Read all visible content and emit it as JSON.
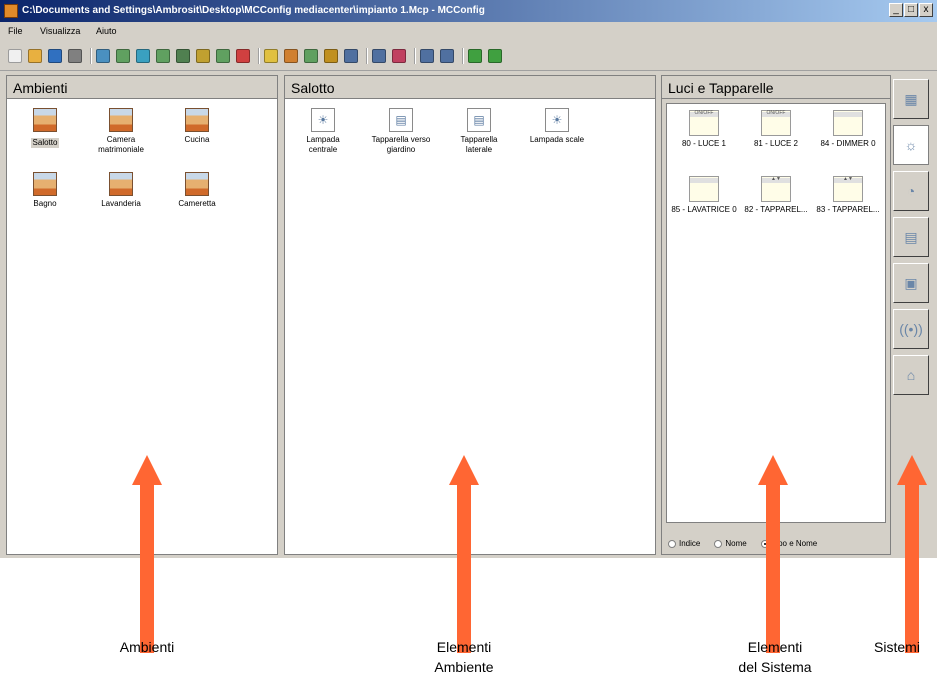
{
  "window": {
    "title": "C:\\Documents and Settings\\Ambrosit\\Desktop\\MCConfig mediacenter\\impianto 1.Mcp - MCConfig",
    "controls": [
      "_",
      "□",
      "x"
    ]
  },
  "menubar": {
    "items": [
      "File",
      "Visualizza",
      "Aiuto"
    ]
  },
  "toolbar": {
    "colors": [
      "#f0f0f0",
      "#e8b040",
      "#3070c0",
      "#808080",
      "#4a90c0",
      "#60a060",
      "#3aa0c0",
      "#60a060",
      "#508050",
      "#c0a030",
      "#60a060",
      "#d04040",
      "#e0c040",
      "#d08030",
      "#60a060",
      "#c09020",
      "#5070a0",
      "#5070a0",
      "#c04060",
      "#5070a0",
      "#5070a0",
      "#40a040",
      "#40a040"
    ]
  },
  "panels": {
    "ambienti": {
      "title": "Ambienti",
      "items": [
        {
          "label": "Salotto",
          "selected": true
        },
        {
          "label": "Camera matrimoniale",
          "selected": false
        },
        {
          "label": "Cucina",
          "selected": false
        },
        {
          "label": "Bagno",
          "selected": false
        },
        {
          "label": "Lavanderia",
          "selected": false
        },
        {
          "label": "Cameretta",
          "selected": false
        }
      ]
    },
    "salotto": {
      "title": "Salotto",
      "items": [
        {
          "label": "Lampada centrale",
          "icon": "lamp-icon"
        },
        {
          "label": "Tapparella verso giardino",
          "icon": "shutter-icon"
        },
        {
          "label": "Tapparella laterale",
          "icon": "shutter-icon"
        },
        {
          "label": "Lampada scale",
          "icon": "lamp-icon"
        }
      ]
    },
    "sistema": {
      "title": "Luci e Tapparelle",
      "items": [
        {
          "label": "80 - LUCE 1",
          "icon": "light-module-icon",
          "top_text": "ON/OFF"
        },
        {
          "label": "81 - LUCE 2",
          "icon": "light-module-icon",
          "top_text": "ON/OFF"
        },
        {
          "label": "84 - DIMMER 0",
          "icon": "dimmer-module-icon",
          "top_text": ""
        },
        {
          "label": "85 - LAVATRICE 0",
          "icon": "dimmer-module-icon",
          "top_text": ""
        },
        {
          "label": "82 - TAPPAREL...",
          "icon": "shutter-module-icon",
          "top_text": "▲▼"
        },
        {
          "label": "83 - TAPPAREL...",
          "icon": "shutter-module-icon",
          "top_text": "▲▼"
        }
      ],
      "sort_options": [
        {
          "label": "Indice",
          "checked": false
        },
        {
          "label": "Nome",
          "checked": false
        },
        {
          "label": "Tipo e Nome",
          "checked": true
        }
      ]
    }
  },
  "sidebar": {
    "buttons": [
      {
        "icon": "system-config-icon",
        "glyph": "▦",
        "active": false
      },
      {
        "icon": "lights-shutters-icon",
        "glyph": "☼",
        "active": true
      },
      {
        "icon": "scenario-icon",
        "glyph": "◔",
        "active": false
      },
      {
        "icon": "audio-video-icon",
        "glyph": "▤",
        "active": false
      },
      {
        "icon": "intercom-icon",
        "glyph": "▣",
        "active": false
      },
      {
        "icon": "wireless-icon",
        "glyph": "((•))",
        "active": false
      },
      {
        "icon": "network-icon",
        "glyph": "⌂",
        "active": false
      }
    ]
  },
  "annotations": {
    "ambienti": "Ambienti",
    "elementi_ambiente_1": "Elementi",
    "elementi_ambiente_2": "Ambiente",
    "elementi_sistema_1": "Elementi",
    "elementi_sistema_2": "del Sistema",
    "sistemi": "Sistemi"
  }
}
